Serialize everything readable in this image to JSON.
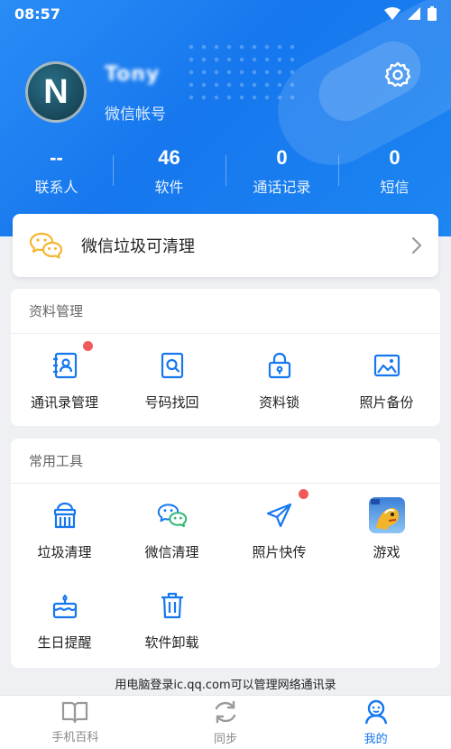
{
  "status_bar": {
    "time": "08:57"
  },
  "profile": {
    "username": "Tony",
    "account_type": "微信帐号",
    "avatar_letter": "N"
  },
  "stats": [
    {
      "value": "--",
      "label": "联系人"
    },
    {
      "value": "46",
      "label": "软件"
    },
    {
      "value": "0",
      "label": "通话记录"
    },
    {
      "value": "0",
      "label": "短信"
    }
  ],
  "wechat_clean": {
    "label": "微信垃圾可清理"
  },
  "data_management": {
    "title": "资料管理",
    "items": [
      {
        "label": "通讯录管理",
        "icon": "contacts-book-icon",
        "badge": true
      },
      {
        "label": "号码找回",
        "icon": "number-search-icon",
        "badge": false
      },
      {
        "label": "资料锁",
        "icon": "lock-icon",
        "badge": false
      },
      {
        "label": "照片备份",
        "icon": "photo-icon",
        "badge": false
      }
    ]
  },
  "common_tools": {
    "title": "常用工具",
    "items": [
      {
        "label": "垃圾清理",
        "icon": "broom-icon",
        "badge": false
      },
      {
        "label": "微信清理",
        "icon": "wechat-icon",
        "badge": true
      },
      {
        "label": "照片快传",
        "icon": "paper-plane-icon",
        "badge": false
      },
      {
        "label": "游戏",
        "icon": "game-app-icon",
        "badge": false
      },
      {
        "label": "生日提醒",
        "icon": "birthday-cake-icon",
        "badge": false
      },
      {
        "label": "软件卸载",
        "icon": "trash-icon",
        "badge": false
      }
    ]
  },
  "footer_note": "用电脑登录ic.qq.com可以管理网络通讯录",
  "bottom_nav": [
    {
      "label": "手机百科",
      "icon": "book-icon",
      "active": false
    },
    {
      "label": "同步",
      "icon": "sync-icon",
      "active": false
    },
    {
      "label": "我的",
      "icon": "user-icon",
      "active": true
    }
  ],
  "colors": {
    "primary": "#1677ee",
    "badge": "#f05a5a",
    "wechat_yellow": "#f5b531"
  }
}
